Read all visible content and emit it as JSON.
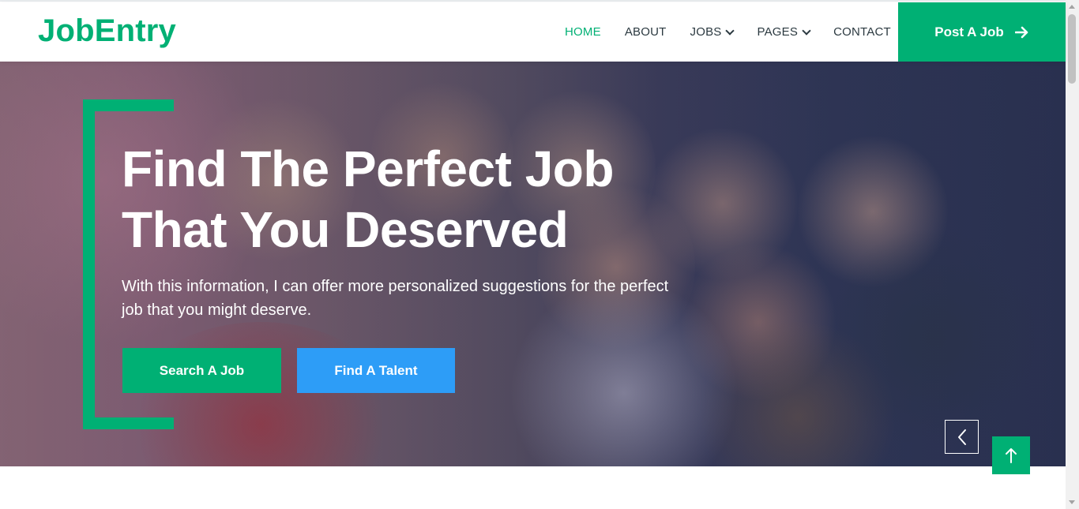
{
  "brand": "JobEntry",
  "nav": {
    "items": [
      {
        "label": "HOME",
        "active": true,
        "dropdown": false
      },
      {
        "label": "ABOUT",
        "active": false,
        "dropdown": false
      },
      {
        "label": "JOBS",
        "active": false,
        "dropdown": true
      },
      {
        "label": "PAGES",
        "active": false,
        "dropdown": true
      },
      {
        "label": "CONTACT",
        "active": false,
        "dropdown": false
      }
    ],
    "cta_label": "Post A Job"
  },
  "hero": {
    "title_line1": "Find The Perfect Job",
    "title_line2": "That You Deserved",
    "text": "With this information, I can offer more personalized suggestions for the perfect job that you might deserve.",
    "primary_button": "Search A Job",
    "secondary_button": "Find A Talent"
  },
  "colors": {
    "accent": "#00B074",
    "secondary": "#2d9df7",
    "text_dark": "#2b3940"
  },
  "icons": {
    "cta": "arrow-right-icon",
    "carousel": "chevron-left-icon",
    "back_to_top": "arrow-up-icon"
  }
}
